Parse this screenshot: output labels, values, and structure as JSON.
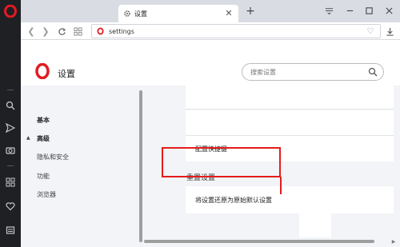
{
  "tab": {
    "title": "设置"
  },
  "address": {
    "url": "settings"
  },
  "header": {
    "title": "设置",
    "search_placeholder": "搜索设置"
  },
  "nav": {
    "items": [
      {
        "label": "基本"
      },
      {
        "label": "高级"
      },
      {
        "label": "隐私和安全"
      },
      {
        "label": "功能"
      },
      {
        "label": "浏览器"
      }
    ]
  },
  "content": {
    "shortcut_label": "配置快捷键",
    "reset_section_title": "重置设置",
    "reset_item_label": "将设置还原为原始默认设置"
  },
  "colors": {
    "accent": "#e51c1c",
    "opera_red": "#cc0f16",
    "sidebar_bg": "#1f2023"
  }
}
